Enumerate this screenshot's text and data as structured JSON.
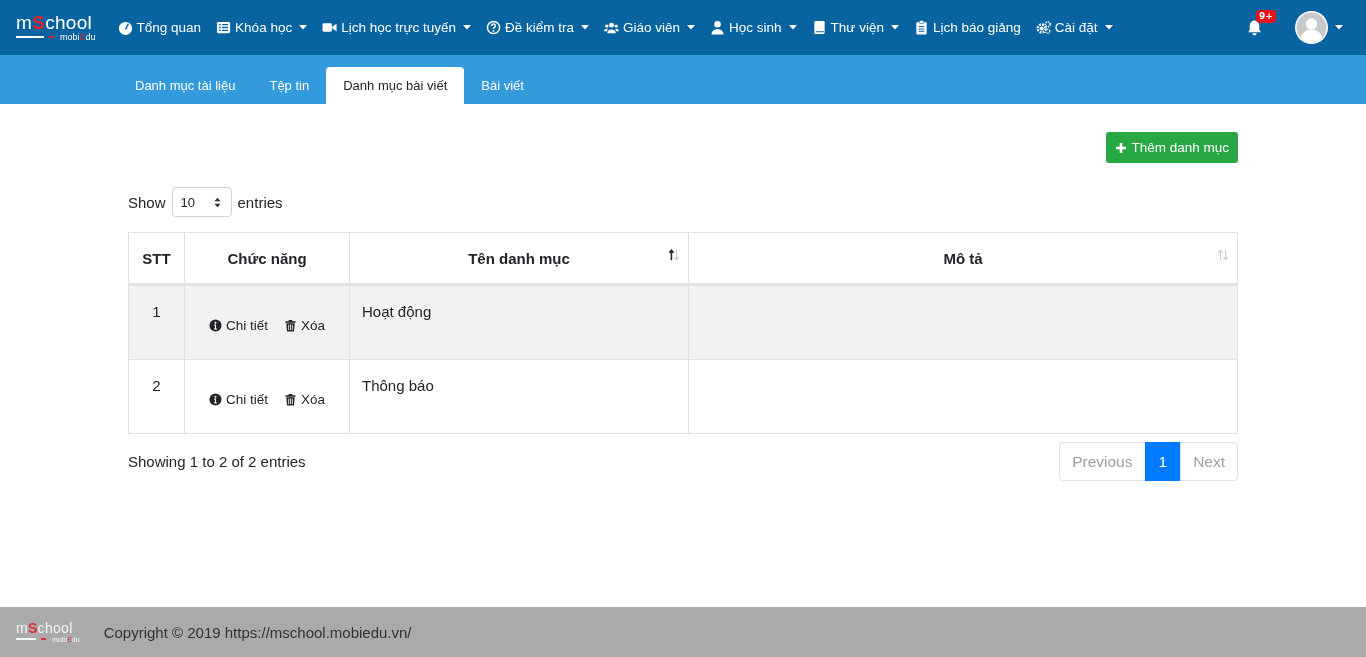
{
  "navbar": {
    "logo": {
      "main": [
        {
          "text": "m",
          "accent": false
        },
        {
          "text": "S",
          "accent": true
        },
        {
          "text": "chool",
          "accent": false
        }
      ],
      "sub": [
        {
          "text": "mobi",
          "accent": false
        },
        {
          "text": "E",
          "accent": true
        },
        {
          "text": "du",
          "accent": false
        }
      ]
    },
    "items": [
      {
        "label": "Tổng quan",
        "kind": "gauge",
        "dropdown": false
      },
      {
        "label": "Khóa học",
        "kind": "list",
        "dropdown": true
      },
      {
        "label": "Lịch học trực tuyến",
        "kind": "video",
        "dropdown": true
      },
      {
        "label": "Đề kiểm tra",
        "kind": "question",
        "dropdown": true
      },
      {
        "label": "Giáo viên",
        "kind": "users",
        "dropdown": true
      },
      {
        "label": "Học sinh",
        "kind": "user",
        "dropdown": true
      },
      {
        "label": "Thư viện",
        "kind": "book",
        "dropdown": true
      },
      {
        "label": "Lịch báo giảng",
        "kind": "clipboard",
        "dropdown": false
      },
      {
        "label": "Cài đặt",
        "kind": "gears",
        "dropdown": true
      }
    ],
    "notifications": {
      "badge": "9+"
    }
  },
  "tabs": [
    {
      "label": "Danh mục tài liệu",
      "selected": false
    },
    {
      "label": "Tệp tin",
      "selected": false
    },
    {
      "label": "Danh mục bài viết",
      "selected": true
    },
    {
      "label": "Bài viết",
      "selected": false
    }
  ],
  "add_button": "Thêm danh mục",
  "length_control": {
    "before": "Show",
    "value": "10",
    "after": "entries"
  },
  "table": {
    "columns": [
      {
        "label": "STT",
        "sortable": false
      },
      {
        "label": "Chức năng",
        "sortable": false
      },
      {
        "label": "Tên danh mục",
        "sortable": true,
        "sorted": true
      },
      {
        "label": "Mô tả",
        "sortable": true,
        "sorted": false
      }
    ],
    "rows": [
      {
        "stt": "1",
        "actions": [
          "Chi tiết",
          "Xóa"
        ],
        "name": "Hoạt động"
      },
      {
        "stt": "2",
        "actions": [
          "Chi tiết",
          "Xóa"
        ],
        "name": "Thông báo"
      }
    ]
  },
  "info": "Showing 1 to 2 of 2 entries",
  "pagination": [
    {
      "label": "Previous",
      "selected": false,
      "disabled": true
    },
    {
      "label": "1",
      "selected": true,
      "disabled": false
    },
    {
      "label": "Next",
      "selected": false,
      "disabled": true
    }
  ],
  "footer": {
    "logo": {
      "main": [
        {
          "text": "m",
          "accent": false
        },
        {
          "text": "S",
          "accent": true
        },
        {
          "text": "chool",
          "accent": false
        }
      ],
      "sub": [
        {
          "text": "mobi",
          "accent": false
        },
        {
          "text": "E",
          "accent": true
        },
        {
          "text": "du",
          "accent": false
        }
      ]
    },
    "copyright": "Copyright © 2019 https://mschool.mobiedu.vn/"
  }
}
